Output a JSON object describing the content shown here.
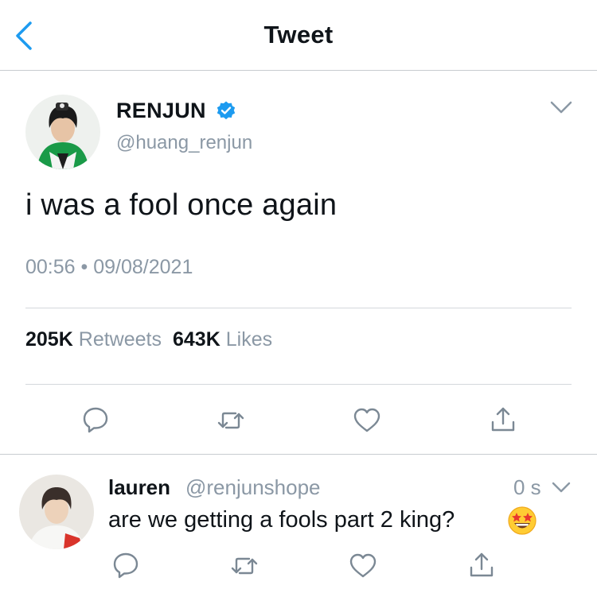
{
  "header": {
    "title": "Tweet",
    "back_icon": "chevron-left-icon"
  },
  "tweet": {
    "author_name": "RENJUN",
    "author_handle": "@huang_renjun",
    "verified": true,
    "text": "i was a fool once again",
    "time": "00:56",
    "separator": "•",
    "date": "09/08/2021",
    "retweets_count": "205K",
    "retweets_label": "Retweets",
    "likes_count": "643K",
    "likes_label": "Likes",
    "actions": [
      "reply-icon",
      "retweet-icon",
      "like-icon",
      "share-icon"
    ]
  },
  "reply": {
    "author_name": "lauren",
    "author_handle": "@renjunshope",
    "time": "0 s",
    "text": "are we getting a fools part 2 king?",
    "emoji": "star-struck",
    "actions": [
      "reply-icon",
      "retweet-icon",
      "like-icon",
      "share-icon"
    ]
  },
  "colors": {
    "accent": "#1d9bf0",
    "secondary_text": "#8b98a5",
    "divider": "#d4d8dc",
    "icon": "#7b8894"
  }
}
